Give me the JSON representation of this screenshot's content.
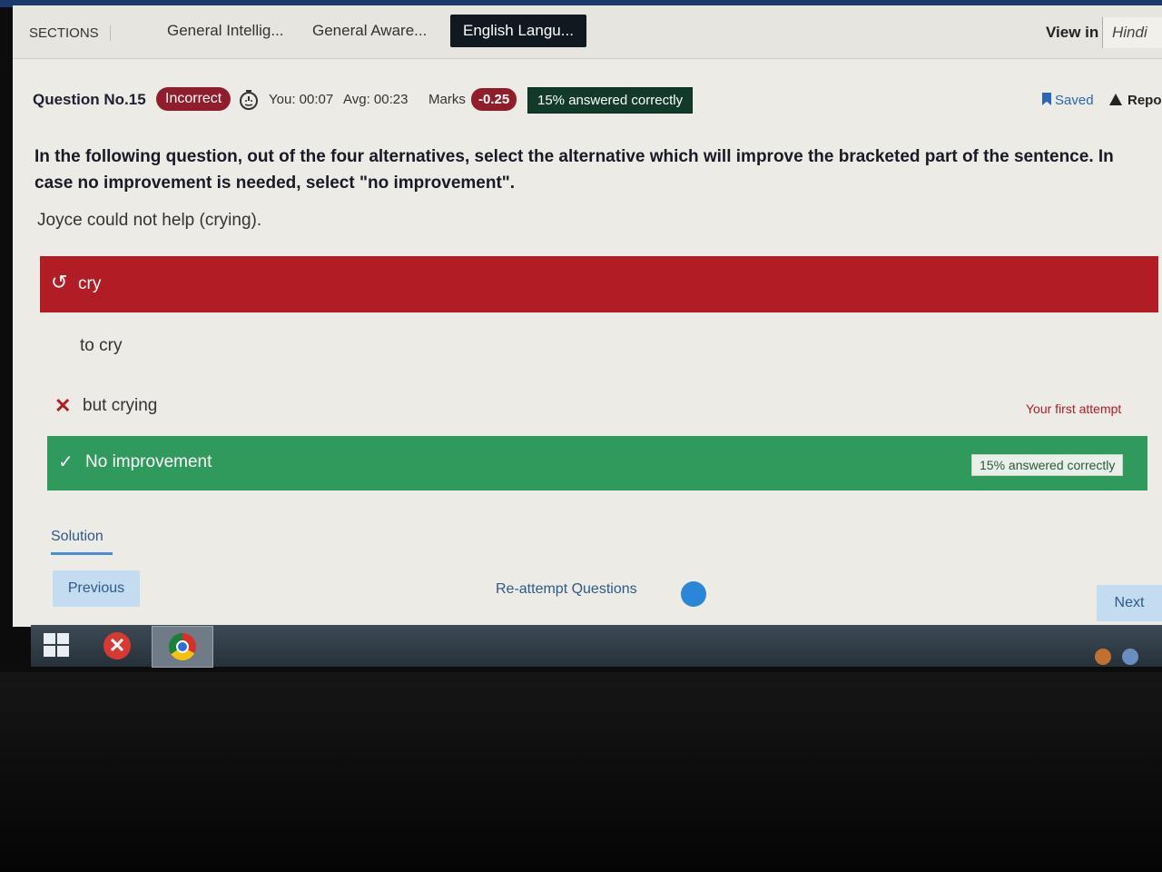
{
  "sections": {
    "label": "SECTIONS",
    "tabs": [
      {
        "label": "General Intellig..."
      },
      {
        "label": "General Aware..."
      },
      {
        "label": "English Langu..."
      }
    ],
    "active_tab_index": 2
  },
  "language": {
    "view_in_label": "View in",
    "option": "Hindi"
  },
  "question_meta": {
    "number_label": "Question No.15",
    "status": "Incorrect",
    "timer_icon": "stopwatch-icon",
    "you_time": "You: 00:07",
    "avg_time": "Avg: 00:23",
    "marks_label": "Marks",
    "marks_value": "-0.25",
    "answered_correctly": "15% answered correctly",
    "saved_label": "Saved",
    "report_label": "Repo"
  },
  "question": {
    "instruction": "In the following question, out of the four alternatives, select the alternative which will improve the bracketed part of the sentence. In case no improvement is needed, select \"no improvement\".",
    "sentence": "Joyce could not help (crying)."
  },
  "options": [
    {
      "label": "cry",
      "state": "selected-wrong",
      "icon": "retry-icon",
      "icon_glyph": "↺"
    },
    {
      "label": "to cry",
      "state": "neutral"
    },
    {
      "label": "but crying",
      "state": "first-attempt-wrong",
      "icon": "cross-icon",
      "icon_glyph": "✕",
      "note": "Your first attempt"
    },
    {
      "label": "No improvement",
      "state": "correct",
      "icon": "check-icon",
      "icon_glyph": "✓",
      "stat": "15% answered correctly"
    }
  ],
  "solution": {
    "tab_label": "Solution"
  },
  "navigation": {
    "previous_label": "Previous",
    "reattempt_label": "Re-attempt Questions",
    "next_label": "Next"
  },
  "taskbar": {
    "close_glyph": "✕"
  },
  "colors": {
    "incorrect": "#b21d25",
    "correct": "#2f9a5c",
    "active_tab": "#101820",
    "link": "#2d5a8a"
  }
}
